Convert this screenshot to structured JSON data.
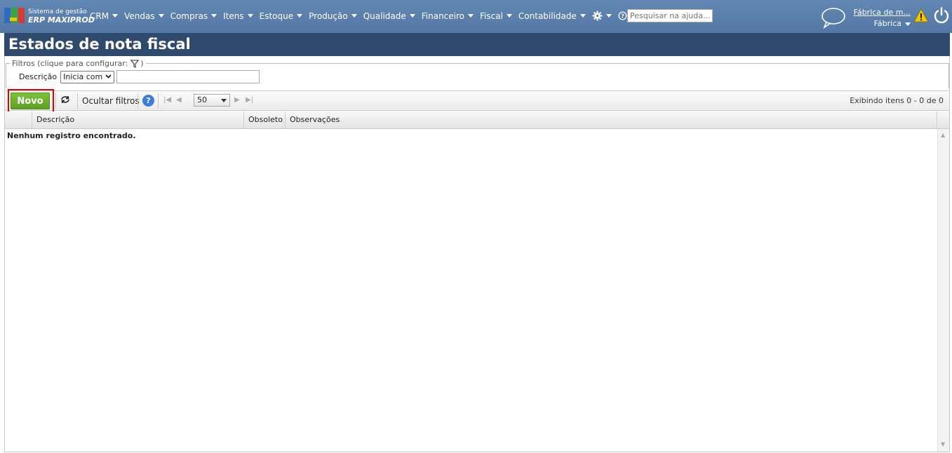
{
  "brand": {
    "line1": "Sistema de gestão",
    "line2": "ERP MAXIPROD"
  },
  "nav": {
    "items": [
      "CRM",
      "Vendas",
      "Compras",
      "Itens",
      "Estoque",
      "Produção",
      "Qualidade",
      "Financeiro",
      "Fiscal",
      "Contabilidade"
    ],
    "search_placeholder": "Pesquisar na ajuda...",
    "company_name": "Fábrica de m...",
    "company_unit": "Fábrica"
  },
  "page": {
    "title": "Estados de nota fiscal"
  },
  "filters": {
    "legend": "Filtros (clique para configurar:",
    "legend_close": ")",
    "field_label": "Descrição",
    "operator": "Inicia com",
    "value": ""
  },
  "toolbar": {
    "new_label": "Novo",
    "hide_filters_label": "Ocultar filtros",
    "help_label": "?",
    "page_size": "50",
    "showing": "Exibindo itens 0 - 0 de 0"
  },
  "grid": {
    "columns": [
      "Descrição",
      "Obsoleto",
      "Observações"
    ],
    "empty_message": "Nenhum registro encontrado."
  },
  "colors": {
    "nav_bg": "#5a7eab",
    "title_bg": "#2f4a6c",
    "new_button": "#6aaf2b",
    "highlight": "#e00000"
  }
}
